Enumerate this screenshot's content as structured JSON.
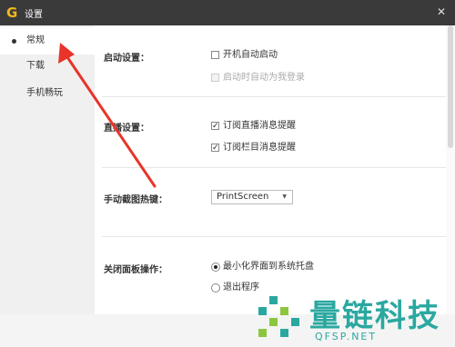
{
  "window": {
    "title": "设置",
    "logo": "G",
    "close": "✕"
  },
  "sidebar": {
    "items": [
      {
        "label": "常规"
      },
      {
        "label": "下载"
      },
      {
        "label": "手机畅玩"
      }
    ]
  },
  "startup": {
    "label": "启动设置：",
    "options": [
      {
        "label": "开机自动启动",
        "checked": false,
        "disabled": false
      },
      {
        "label": "启动时自动为我登录",
        "checked": false,
        "disabled": true
      }
    ]
  },
  "live": {
    "label": "直播设置：",
    "options": [
      {
        "label": "订阅直播消息提醒",
        "checked": true,
        "mark": "✓"
      },
      {
        "label": "订阅栏目消息提醒",
        "checked": true,
        "mark": "✓"
      }
    ]
  },
  "hotkey": {
    "label": "手动截图热键：",
    "value": "PrintScreen",
    "arrow": "▼"
  },
  "panel": {
    "label": "关闭面板操作：",
    "options": [
      {
        "label": "最小化界面到系统托盘",
        "selected": true
      },
      {
        "label": "退出程序",
        "selected": false
      }
    ]
  },
  "watermark": {
    "text": "量链科技",
    "url": "QFSP.NET",
    "color": "#2aa8a0"
  },
  "annotation": {
    "arrow_color": "#e8342a"
  }
}
